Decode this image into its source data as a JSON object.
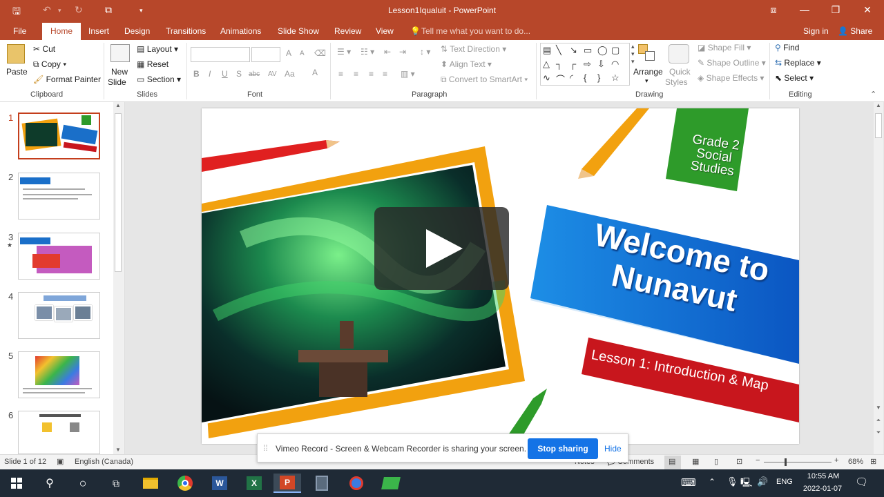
{
  "titlebar": {
    "title": "Lesson1Iqualuit  -  PowerPoint"
  },
  "tabs": [
    "File",
    "Home",
    "Insert",
    "Design",
    "Transitions",
    "Animations",
    "Slide Show",
    "Review",
    "View"
  ],
  "tell_me": "Tell me what you want to do...",
  "account": {
    "signin": "Sign in",
    "share": "Share"
  },
  "clipboard": {
    "paste": "Paste",
    "cut": "Cut",
    "copy": "Copy",
    "format_painter": "Format Painter",
    "label": "Clipboard"
  },
  "slides_grp": {
    "new_slide_1": "New",
    "new_slide_2": "Slide",
    "layout": "Layout",
    "reset": "Reset",
    "section": "Section",
    "label": "Slides"
  },
  "font_grp": {
    "label": "Font",
    "bold": "B",
    "italic": "I",
    "underline": "U",
    "shadow": "S",
    "strike": "abc",
    "spacing": "AV",
    "case": "Aa",
    "grow": "A",
    "shrink": "A",
    "color": "A"
  },
  "paragraph_grp": {
    "text_direction": "Text Direction",
    "align_text": "Align Text",
    "convert_smartart": "Convert to SmartArt",
    "label": "Paragraph"
  },
  "drawing_grp": {
    "arrange": "Arrange",
    "quick_styles_1": "Quick",
    "quick_styles_2": "Styles",
    "shape_fill": "Shape Fill",
    "shape_outline": "Shape Outline",
    "shape_effects": "Shape Effects",
    "label": "Drawing"
  },
  "editing_grp": {
    "find": "Find",
    "replace": "Replace",
    "select": "Select",
    "label": "Editing"
  },
  "thumbnails": [
    {
      "num": "1"
    },
    {
      "num": "2"
    },
    {
      "num": "3",
      "star": "★"
    },
    {
      "num": "4"
    },
    {
      "num": "5"
    },
    {
      "num": "6"
    }
  ],
  "slide": {
    "grade_line1": "Grade 2",
    "grade_line2": "Social",
    "grade_line3": "Studies",
    "welcome_line1": "Welcome to",
    "welcome_line2": "Nunavut",
    "lesson": "Lesson 1: Introduction & Map"
  },
  "status": {
    "slide_of": "Slide 1 of 12",
    "language": "English (Canada)",
    "notes": "Notes",
    "comments": "Comments",
    "zoom": "68%"
  },
  "notification": {
    "message": "Vimeo Record - Screen & Webcam Recorder is sharing your screen.",
    "stop": "Stop sharing",
    "hide": "Hide"
  },
  "clock": {
    "time": "10:55 AM",
    "date": "2022-01-07",
    "lang": "ENG"
  },
  "colors": {
    "accent": "#b7472a",
    "slide_blue": "#1a6fc9",
    "slide_green": "#2e9b2a",
    "slide_red": "#c8161d",
    "frame_orange": "#f2a10f",
    "stop_btn": "#1473e6"
  }
}
